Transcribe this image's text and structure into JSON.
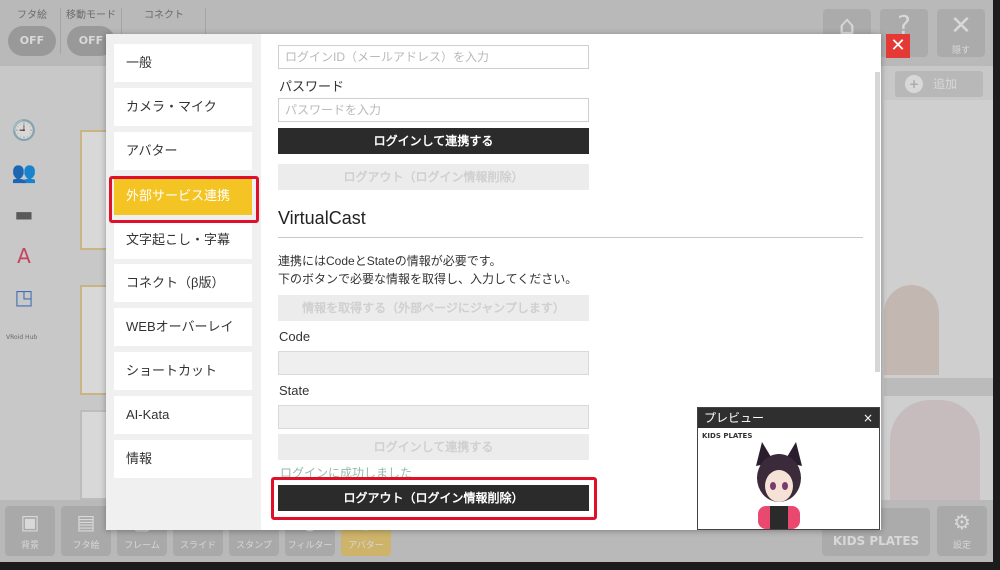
{
  "topbar": {
    "toggles": [
      {
        "label": "フタ絵",
        "value": "OFF"
      },
      {
        "label": "移動モード",
        "value": "OFF"
      },
      {
        "label": "コネクト",
        "value": ""
      }
    ],
    "help_label": "?",
    "close_label": "隠す"
  },
  "leftbar": {
    "vroid_label": "VRoid Hub"
  },
  "background": {
    "add_label": "追加"
  },
  "bottombar": {
    "buttons": [
      "背景",
      "フタ絵",
      "フレーム",
      "スライド",
      "スタンプ",
      "フィルター",
      "アバター"
    ],
    "settings_label": "設定",
    "brand_label": "KIDS PLATES"
  },
  "dialog": {
    "nav": [
      "一般",
      "カメラ・マイク",
      "アバター",
      "外部サービス連携",
      "文字起こし・字幕",
      "コネクト（β版）",
      "WEBオーバーレイ",
      "ショートカット",
      "AI-Kata",
      "情報"
    ],
    "active_index": 3,
    "login_id_placeholder": "ログインID（メールアドレス）を入力",
    "password_label": "パスワード",
    "password_placeholder": "パスワードを入力",
    "login_button": "ログインして連携する",
    "logout_button_disabled": "ログアウト（ログイン情報削除）",
    "virtualcast": {
      "heading": "VirtualCast",
      "desc_line1": "連携にはCodeとStateの情報が必要です。",
      "desc_line2": "下のボタンで必要な情報を取得し、入力してください。",
      "get_info_button": "情報を取得する（外部ページにジャンプします）",
      "code_label": "Code",
      "state_label": "State",
      "login_button": "ログインして連携する",
      "success_message": "ログインに成功しました",
      "logout_button": "ログアウト（ログイン情報削除）"
    },
    "close_label": "✕"
  },
  "preview": {
    "title": "プレビュー",
    "close_label": "×",
    "logo": "KIDS PLATES"
  },
  "colors": {
    "accent_yellow": "#f4c424",
    "highlight_red": "#e0102b",
    "dark_button": "#2b2b2b"
  }
}
